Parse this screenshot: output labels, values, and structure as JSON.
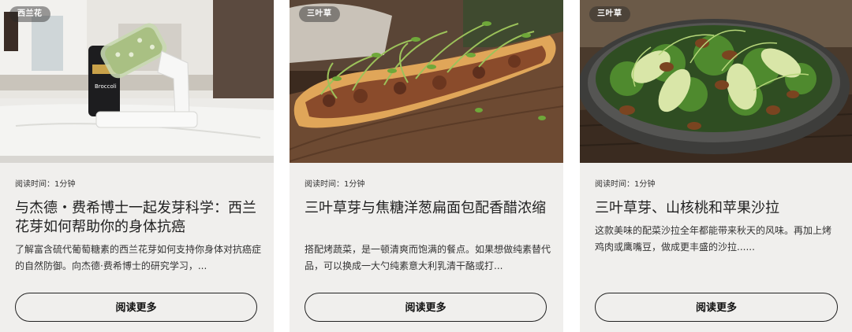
{
  "cards": [
    {
      "tag": "西兰花",
      "image": "sprouting-jar-kitchen-photo",
      "read_time": "阅读时间：1分钟",
      "title": "与杰德・费希博士一起发芽科学：西兰花芽如何帮助你的身体抗癌",
      "excerpt": "了解富含硫代葡萄糖素的西兰花芽如何支持你身体对抗癌症的自然防御。向杰德·费希博士的研究学习，...",
      "button": "阅读更多",
      "package_label": "Broccoli"
    },
    {
      "tag": "三叶草",
      "image": "flatbread-with-sprouts-photo",
      "read_time": "阅读时间：1分钟",
      "title": "三叶草芽与焦糖洋葱扁面包配香醋浓缩",
      "excerpt": "搭配烤蔬菜，是一顿清爽而饱满的餐点。如果想做纯素替代品，可以换成一大勺纯素意大利乳清干酪或打...",
      "button": "阅读更多"
    },
    {
      "tag": "三叶草",
      "image": "apple-pecan-salad-photo",
      "read_time": "阅读时间：1分钟",
      "title": "三叶草芽、山核桃和苹果沙拉",
      "excerpt": "这款美味的配菜沙拉全年都能带来秋天的风味。再加上烤鸡肉或鹰嘴豆，做成更丰盛的沙拉......",
      "button": "阅读更多"
    }
  ]
}
